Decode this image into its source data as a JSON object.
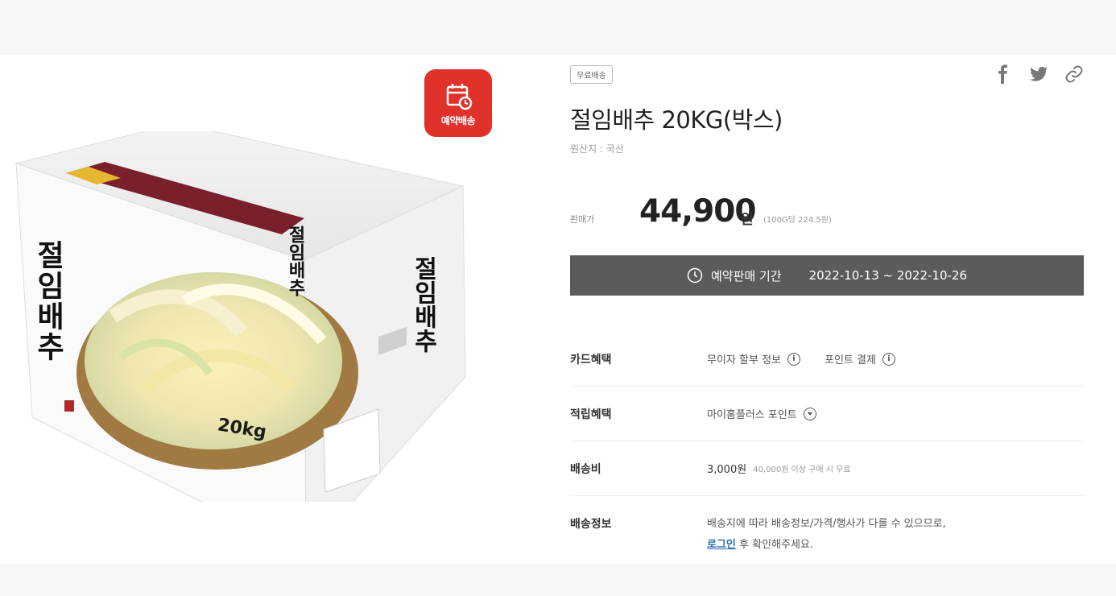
{
  "badge": {
    "reserve_delivery": "예약배송"
  },
  "box": {
    "front_title": "절임배추",
    "side_title": "절임배추",
    "top_title": "절임배추",
    "weight": "20kg"
  },
  "product": {
    "free_shipping": "무료배송",
    "name": "절임배추 20KG(박스)",
    "origin": "원산지 : 국산",
    "price_label": "판매가",
    "price": "44,900",
    "price_unit": "원",
    "unit_price": "(100G당 224.5원)"
  },
  "reservation": {
    "label": "예약판매 기간",
    "period": "2022-10-13 ~ 2022-10-26"
  },
  "rows": {
    "card": {
      "label": "카드혜택",
      "item1": "무이자 할부 정보",
      "item2": "포인트 결제"
    },
    "points": {
      "label": "적립혜택",
      "value": "마이홈플러스 포인트"
    },
    "shipping_fee": {
      "label": "배송비",
      "value": "3,000원",
      "note": "40,000원 이상 구매 시 무료"
    },
    "shipping_info": {
      "label": "배송정보",
      "line1": "배송지에 따라 배송정보/가격/행사가 다를 수 있으므로,",
      "login": "로그인",
      "line2_rest": " 후 확인해주세요."
    }
  },
  "share_icons": [
    "facebook-icon",
    "twitter-icon",
    "link-icon"
  ]
}
